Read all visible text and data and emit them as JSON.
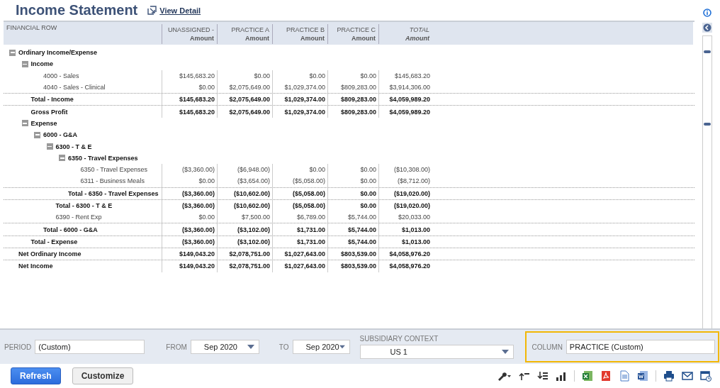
{
  "title": "Income Statement",
  "view_link": "View Detail",
  "columns": [
    {
      "top": "FINANCIAL ROW",
      "italic": false
    },
    {
      "top": "UNASSIGNED -",
      "sub": "Amount",
      "italic": false
    },
    {
      "top": "PRACTICE A",
      "sub": "Amount",
      "italic": false
    },
    {
      "top": "PRACTICE B",
      "sub": "Amount",
      "italic": false
    },
    {
      "top": "PRACTICE C",
      "sub": "Amount",
      "italic": false
    },
    {
      "top": "TOTAL",
      "sub": "Amount",
      "italic": true
    }
  ],
  "rows": [
    {
      "kind": "group",
      "label": "Ordinary Income/Expense",
      "expanded": true,
      "children": [
        {
          "kind": "group",
          "label": "Income",
          "expanded": true,
          "children": [
            {
              "kind": "line",
              "label": "4000 - Sales",
              "values": [
                "$145,683.20",
                "$0.00",
                "$0.00",
                "$0.00",
                "$145,683.20"
              ]
            },
            {
              "kind": "line",
              "label": "4040 - Sales - Clinical",
              "values": [
                "$0.00",
                "$2,075,649.00",
                "$1,029,374.00",
                "$809,283.00",
                "$3,914,306.00"
              ]
            }
          ]
        },
        {
          "kind": "total",
          "label": "Total - Income",
          "values": [
            "$145,683.20",
            "$2,075,649.00",
            "$1,029,374.00",
            "$809,283.00",
            "$4,059,989.20"
          ]
        },
        {
          "kind": "total",
          "label": "Gross Profit",
          "values": [
            "$145,683.20",
            "$2,075,649.00",
            "$1,029,374.00",
            "$809,283.00",
            "$4,059,989.20"
          ]
        },
        {
          "kind": "group",
          "label": "Expense",
          "expanded": true,
          "children": [
            {
              "kind": "group",
              "label": "6000 - G&A",
              "expanded": true,
              "children": [
                {
                  "kind": "group",
                  "label": "6300 - T & E",
                  "expanded": true,
                  "children": [
                    {
                      "kind": "group",
                      "label": "6350 - Travel Expenses",
                      "expanded": true,
                      "children": [
                        {
                          "kind": "line",
                          "label": "6350 - Travel Expenses",
                          "values": [
                            "($3,360.00)",
                            "($6,948.00)",
                            "$0.00",
                            "$0.00",
                            "($10,308.00)"
                          ]
                        },
                        {
                          "kind": "line",
                          "label": "6311 - Business Meals",
                          "values": [
                            "$0.00",
                            "($3,654.00)",
                            "($5,058.00)",
                            "$0.00",
                            "($8,712.00)"
                          ]
                        }
                      ]
                    },
                    {
                      "kind": "total",
                      "label": "Total - 6350 - Travel Expenses",
                      "values": [
                        "($3,360.00)",
                        "($10,602.00)",
                        "($5,058.00)",
                        "$0.00",
                        "($19,020.00)"
                      ]
                    }
                  ]
                },
                {
                  "kind": "total",
                  "label": "Total - 6300 - T & E",
                  "values": [
                    "($3,360.00)",
                    "($10,602.00)",
                    "($5,058.00)",
                    "$0.00",
                    "($19,020.00)"
                  ]
                },
                {
                  "kind": "line",
                  "label": "6390 - Rent Exp",
                  "values": [
                    "$0.00",
                    "$7,500.00",
                    "$6,789.00",
                    "$5,744.00",
                    "$20,033.00"
                  ]
                }
              ]
            },
            {
              "kind": "total",
              "label": "Total - 6000 - G&A",
              "values": [
                "($3,360.00)",
                "($3,102.00)",
                "$1,731.00",
                "$5,744.00",
                "$1,013.00"
              ]
            }
          ]
        },
        {
          "kind": "total",
          "label": "Total - Expense",
          "values": [
            "($3,360.00)",
            "($3,102.00)",
            "$1,731.00",
            "$5,744.00",
            "$1,013.00"
          ]
        }
      ]
    },
    {
      "kind": "total",
      "label": "Net Ordinary Income",
      "values": [
        "$149,043.20",
        "$2,078,751.00",
        "$1,027,643.00",
        "$803,539.00",
        "$4,058,976.20"
      ]
    },
    {
      "kind": "total",
      "label": "Net Income",
      "values": [
        "$149,043.20",
        "$2,078,751.00",
        "$1,027,643.00",
        "$803,539.00",
        "$4,058,976.20"
      ]
    }
  ],
  "filters": [
    {
      "kind": "text",
      "label": "PERIOD",
      "value": "(Custom)",
      "highlighted": false
    },
    {
      "kind": "dropdown",
      "label": "FROM",
      "value": "Sep 2020",
      "highlighted": false
    },
    {
      "kind": "dropdown",
      "label": "TO",
      "value": "Sep 2020",
      "highlighted": false
    },
    {
      "kind": "stacked_dropdown",
      "label": "SUBSIDIARY CONTEXT",
      "value": "US 1",
      "highlighted": false
    },
    {
      "kind": "text",
      "label": "COLUMN",
      "value": "PRACTICE (Custom)",
      "highlighted": true
    }
  ],
  "buttons": [
    {
      "label": "Refresh",
      "primary": true
    },
    {
      "label": "Customize",
      "primary": false
    }
  ]
}
